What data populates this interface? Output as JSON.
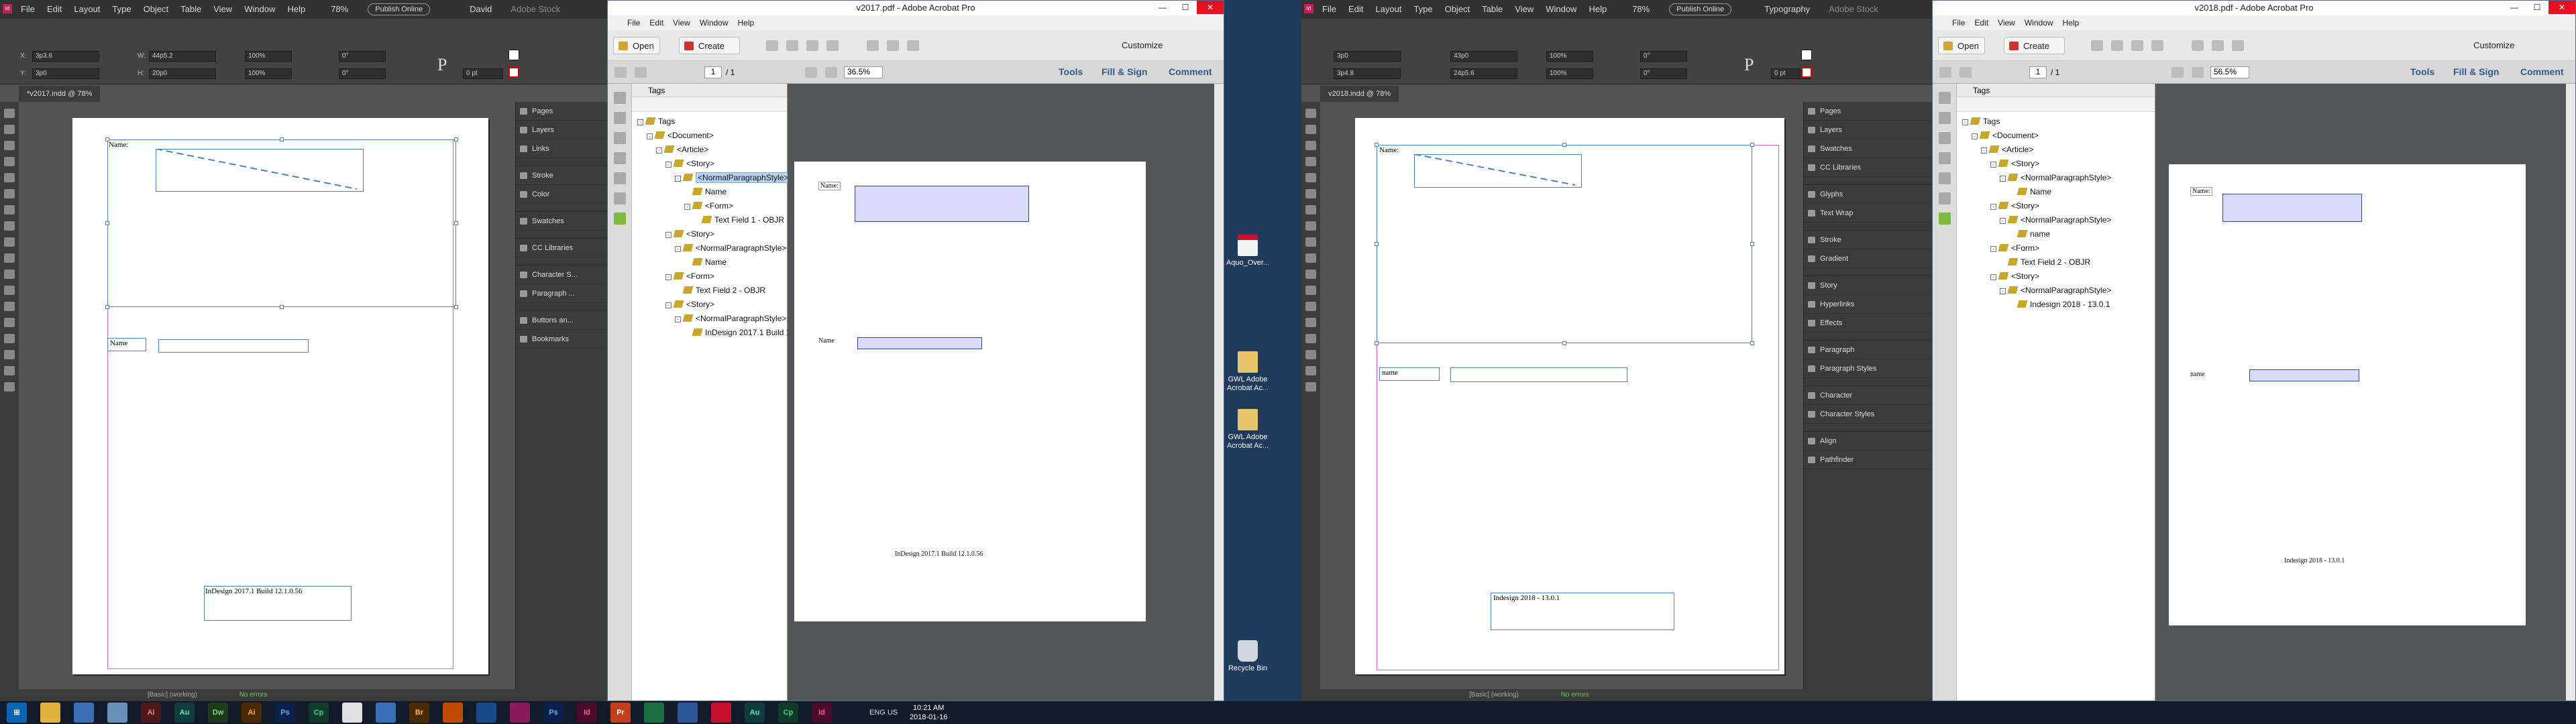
{
  "indesign_left": {
    "menu": [
      "File",
      "Edit",
      "Layout",
      "Type",
      "Object",
      "Table",
      "View",
      "Window",
      "Help"
    ],
    "zoom": "78%",
    "publish": "Publish Online",
    "user": "David",
    "search_placeholder": "Adobe Stock",
    "fields": {
      "x": "3p3.6",
      "y": "3p0",
      "w": "44p5.2",
      "h": "20p0",
      "scale_x": "100%",
      "scale_y": "100%",
      "angle": "0°",
      "shear": "0°",
      "stroke": "0 pt"
    },
    "doc_tab": "*v2017.indd @ 78%",
    "panels": [
      {
        "group": [
          "Pages",
          "Layers",
          "Links"
        ]
      },
      {
        "group": [
          "Stroke",
          "Color"
        ]
      },
      {
        "group": [
          "Swatches"
        ]
      },
      {
        "group": [
          "CC Libraries"
        ]
      },
      {
        "group": [
          "Character S...",
          "Paragraph ..."
        ]
      },
      {
        "group": [
          "Buttons an...",
          "Bookmarks"
        ]
      }
    ],
    "frame_labels": {
      "name1": "Name:",
      "name2": "Name",
      "footer": "InDesign 2017.1 Build 12.1.0.56"
    },
    "status": "[Basic] (working)",
    "errors": "No errors"
  },
  "acrobat_left": {
    "title": "v2017.pdf - Adobe Acrobat Pro",
    "menu": [
      "File",
      "Edit",
      "View",
      "Window",
      "Help"
    ],
    "open": "Open",
    "create": "Create",
    "customize": "Customize",
    "page": "1",
    "pages": "/ 1",
    "zoom": "36.5%",
    "right_tabs": [
      "Tools",
      "Fill & Sign",
      "Comment"
    ],
    "panel_title": "Tags",
    "tree": [
      {
        "d": 0,
        "t": "Tags",
        "exp": "-"
      },
      {
        "d": 1,
        "t": "<Document>",
        "exp": "-"
      },
      {
        "d": 2,
        "t": "<Article>",
        "exp": "-"
      },
      {
        "d": 3,
        "t": "<Story>",
        "exp": "-"
      },
      {
        "d": 4,
        "t": "<NormalParagraphStyle>",
        "exp": "-",
        "sel": true
      },
      {
        "d": 5,
        "t": "Name"
      },
      {
        "d": 5,
        "t": "<Form>",
        "exp": "-"
      },
      {
        "d": 6,
        "t": "Text Field 1 - OBJR"
      },
      {
        "d": 3,
        "t": "<Story>",
        "exp": "-"
      },
      {
        "d": 4,
        "t": "<NormalParagraphStyle>",
        "exp": "-"
      },
      {
        "d": 5,
        "t": "Name"
      },
      {
        "d": 3,
        "t": "<Form>",
        "exp": "-"
      },
      {
        "d": 4,
        "t": "Text Field 2 - OBJR"
      },
      {
        "d": 3,
        "t": "<Story>",
        "exp": "-"
      },
      {
        "d": 4,
        "t": "<NormalParagraphStyle>",
        "exp": "-"
      },
      {
        "d": 5,
        "t": "InDesign 2017.1 Build 12.1.0.56"
      }
    ],
    "page_labels": {
      "name1": "Name:",
      "name2": "Name",
      "footer": "InDesign 2017.1 Build 12.1.0.56"
    }
  },
  "desktop": {
    "icons": [
      "Aquo_Over...",
      "GWL Adobe Acrobat Ac...",
      "GWL Adobe Acrobat Ac...",
      "Recycle Bin"
    ]
  },
  "indesign_right": {
    "menu": [
      "File",
      "Edit",
      "Layout",
      "Type",
      "Object",
      "Table",
      "View",
      "Window",
      "Help"
    ],
    "zoom": "78%",
    "publish": "Publish Online",
    "user": "Typography",
    "search_placeholder": "Adobe Stock",
    "fields": {
      "x": "3p0",
      "y": "3p4.8",
      "w": "43p0",
      "h": "24p5.6",
      "scale_x": "100%",
      "scale_y": "100%",
      "angle": "0°",
      "shear": "0°",
      "stroke": "0 pt"
    },
    "doc_tab": "v2018.indd @ 78%",
    "panels": [
      {
        "group": [
          "Pages",
          "Layers",
          "Swatches",
          "CC Libraries"
        ]
      },
      {
        "group": [
          "Glyphs",
          "Text Wrap"
        ]
      },
      {
        "group": [
          "Stroke",
          "Gradient"
        ]
      },
      {
        "group": [
          "Story",
          "Hyperlinks",
          "Effects"
        ]
      },
      {
        "group": [
          "Paragraph",
          "Paragraph Styles"
        ]
      },
      {
        "group": [
          "Character",
          "Character Styles"
        ]
      },
      {
        "group": [
          "Align",
          "Pathfinder"
        ]
      }
    ],
    "frame_labels": {
      "name1": "Name:",
      "name2": "name",
      "footer": "Indesign 2018 - 13.0.1"
    },
    "status": "[Basic] (working)",
    "errors": "No errors"
  },
  "acrobat_right": {
    "title": "v2018.pdf - Adobe Acrobat Pro",
    "menu": [
      "File",
      "Edit",
      "View",
      "Window",
      "Help"
    ],
    "open": "Open",
    "create": "Create",
    "customize": "Customize",
    "page": "1",
    "pages": "/ 1",
    "zoom": "56.5%",
    "right_tabs": [
      "Tools",
      "Fill & Sign",
      "Comment"
    ],
    "panel_title": "Tags",
    "tree": [
      {
        "d": 0,
        "t": "Tags",
        "exp": "-"
      },
      {
        "d": 1,
        "t": "<Document>",
        "exp": "-"
      },
      {
        "d": 2,
        "t": "<Article>",
        "exp": "-"
      },
      {
        "d": 3,
        "t": "<Story>",
        "exp": "-"
      },
      {
        "d": 4,
        "t": "<NormalParagraphStyle>",
        "exp": "-"
      },
      {
        "d": 5,
        "t": "Name"
      },
      {
        "d": 3,
        "t": "<Story>",
        "exp": "-"
      },
      {
        "d": 4,
        "t": "<NormalParagraphStyle>",
        "exp": "-"
      },
      {
        "d": 5,
        "t": "name"
      },
      {
        "d": 3,
        "t": "<Form>",
        "exp": "-"
      },
      {
        "d": 4,
        "t": "Text Field 2 - OBJR"
      },
      {
        "d": 3,
        "t": "<Story>",
        "exp": "-"
      },
      {
        "d": 4,
        "t": "<NormalParagraphStyle>",
        "exp": "-"
      },
      {
        "d": 5,
        "t": "Indesign 2018 - 13.0.1"
      }
    ],
    "page_labels": {
      "name1": "Name:",
      "name2": "name",
      "footer": "Indesign 2018 - 13.0.1"
    }
  },
  "taskbar": {
    "apps": [
      "Ai",
      "Au",
      "Dw",
      "Ai",
      "Ps",
      "Cp",
      "Br",
      "Ps",
      "Id",
      "Pr",
      "Ai",
      "Au",
      "Cp",
      "Id"
    ],
    "lang": "ENG US",
    "time": "10:21 AM",
    "date": "2018-01-16"
  }
}
